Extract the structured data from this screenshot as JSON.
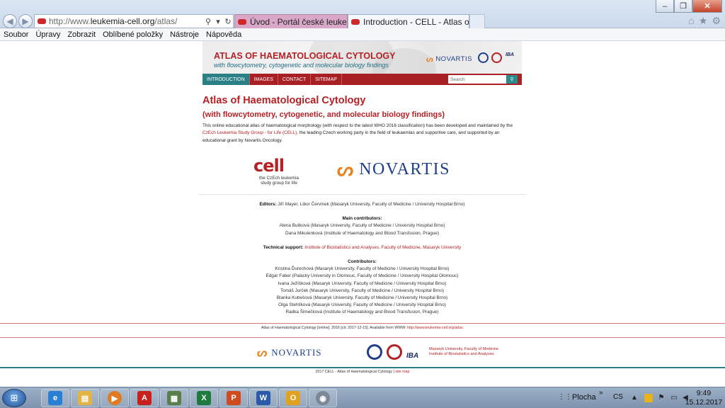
{
  "browser": {
    "address_prefix": "http://www.",
    "address_domain": "leukemia-cell.org",
    "address_path": "/atlas/",
    "tabs": [
      {
        "label": "Úvod - Portál české leukemické ..."
      },
      {
        "label": "Introduction - CELL - Atlas of..."
      }
    ],
    "menu": [
      "Soubor",
      "Úpravy",
      "Zobrazit",
      "Oblíbené položky",
      "Nástroje",
      "Nápověda"
    ]
  },
  "site": {
    "banner_title": "ATLAS OF HAEMATOLOGICAL CYTOLOGY",
    "banner_subtitle": "with flowcytometry, cytogenetic and molecular biology findings",
    "banner_novartis": "NOVARTIS",
    "banner_iba": "IBA",
    "nav": [
      "INTRODUCTION",
      "IMAGES",
      "CONTACT",
      "SITEMAP"
    ],
    "search_placeholder": "Search",
    "heading": "Atlas of Haematological Cytology",
    "subheading": "(with flowcytometry, cytogenetic, and molecular biology findings)",
    "intro_1": "This online educational atlas of haematological morphology (with respect to the latest WHO 2016 classification) has been developed and maintained by the",
    "intro_link": "CzEch Leukemia Study Group - for Life (CELL),",
    "intro_2": " the leading Czech working party in the field of leukaemias and supportive care, and supported by an educational grant by Novartis Oncology.",
    "cell_logo_word": "cell",
    "cell_logo_sub1": "the CzEch leukemia",
    "cell_logo_sub2": "study group for life",
    "novartis_word": "NOVARTIS"
  },
  "credits": {
    "editors_label": "Editors:",
    "editors": " Jiří Mayer, Libor Červinek (Masaryk University, Faculty of Medicine / University Hospital Brno)",
    "main_label": "Main contributors:",
    "main": [
      "Alena Buliková (Masaryk University, Faculty of Medicine / University Hospital Brno)",
      "Dana Mikulenková (Institute of Haematology and Blood Transfusion, Prague)"
    ],
    "tech_label": "Technical support:",
    "tech": " Institute of Biostatistics and Analyses, Faculty of Medicine, Masaryk University",
    "contrib_label": "Contributors:",
    "contributors": [
      "Kristina Ďurechová (Masaryk University, Faculty of Medicine / University Hospital Brno)",
      "Edgar Faber (Palacky University in Olomouc, Faculty of Medicine / University Hospital Olomouc)",
      "Ivana Ježíšková (Masaryk University, Faculty of Medicine / University Hospital Brno)",
      "Tomáš Jurček (Masaryk University, Faculty of Medicine / University Hospital Brno)",
      "Blanka Kubešová (Masaryk University, Faculty of Medicine / University Hospital Brno)",
      "Olga Stehlíková (Masaryk University, Faculty of Medicine / University Hospital Brno)",
      "Radka Šimečková (Institute of Haematology and Blood Transfusion, Prague)"
    ]
  },
  "footer": {
    "citation": "Atlas of Haematological Cytology [online]. 2016 [cit. 2017-12-15]. Available from WWW: ",
    "citation_link": "http://www.leukemia-cell.org/atlas.",
    "novartis": "NOVARTIS",
    "iba": "IBA",
    "institute_1": "Masaryk University, Faculty of Medicine",
    "institute_2": "Institute of Biostatistics and Analyses",
    "copyright": "2017 CELL - Atlas of Haematological Cytology | ",
    "sitemap": "site map"
  },
  "taskbar": {
    "desktop_label": "Plocha",
    "lang": "CS",
    "time": "9:49",
    "date": "15.12.2017"
  },
  "colors": {
    "brand_red": "#b52025",
    "nav_active": "#2b7f86",
    "novartis_blue": "#1e3f8a",
    "novartis_orange": "#e8831e"
  }
}
